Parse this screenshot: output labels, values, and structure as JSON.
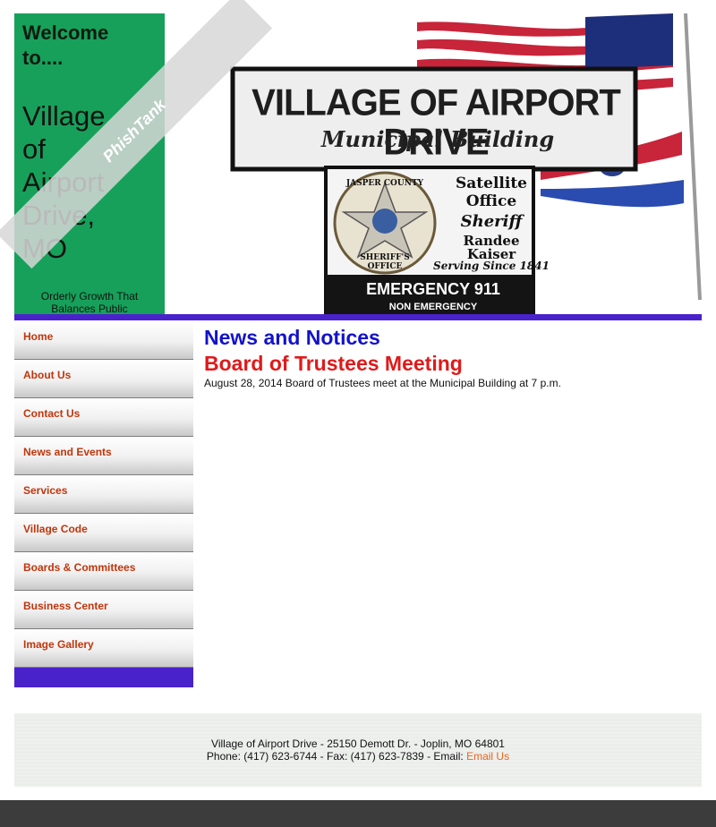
{
  "header": {
    "welcome_line1": "Welcome",
    "welcome_line2": "to....",
    "village_line1": "Village",
    "village_line2": "of",
    "village_line3": "Airport",
    "village_line4": "Drive,",
    "village_line5": "MO",
    "tagline_line1": "Orderly Growth That",
    "tagline_line2": "Balances Public",
    "sign": {
      "title": "VILLAGE OF AIRPORT DRIVE",
      "subtitle": "Municipal Building",
      "sheriff_line1": "Satellite",
      "sheriff_line2": "Office",
      "sheriff_line3": "Sheriff",
      "sheriff_line4": "Randee",
      "sheriff_line5": "Kaiser",
      "sheriff_line6": "Serving Since 1841",
      "badge_top": "JASPER COUNTY",
      "badge_bottom": "SHERIFF'S OFFICE",
      "emergency": "EMERGENCY 911",
      "non_emergency": "NON EMERGENCY"
    },
    "watermark": "PhishTank"
  },
  "nav": {
    "items": [
      {
        "label": "Home"
      },
      {
        "label": "About Us"
      },
      {
        "label": "Contact Us"
      },
      {
        "label": "News and Events"
      },
      {
        "label": "Services"
      },
      {
        "label": "Village Code"
      },
      {
        "label": "Boards & Committees"
      },
      {
        "label": "Business Center"
      },
      {
        "label": "Image Gallery"
      }
    ]
  },
  "main": {
    "heading": "News and Notices",
    "news": [
      {
        "title": "Board of Trustees Meeting",
        "body": "August 28, 2014 Board of Trustees meet at the Municipal Building at 7 p.m."
      }
    ]
  },
  "footer": {
    "address": "Village of Airport Drive - 25150 Demott Dr. - Joplin, MO 64801",
    "phone_fax": "Phone: (417) 623-6744 - Fax: (417) 623-7839 - Email: ",
    "email_label": "Email Us"
  },
  "colors": {
    "green_panel": "#17a05a",
    "accent_purple": "#4a22cc",
    "nav_text": "#c0360c",
    "heading_blue": "#1212cc",
    "news_red": "#e01a1a",
    "email_orange": "#e8661a",
    "bottom_bar": "#3c3c3c"
  }
}
